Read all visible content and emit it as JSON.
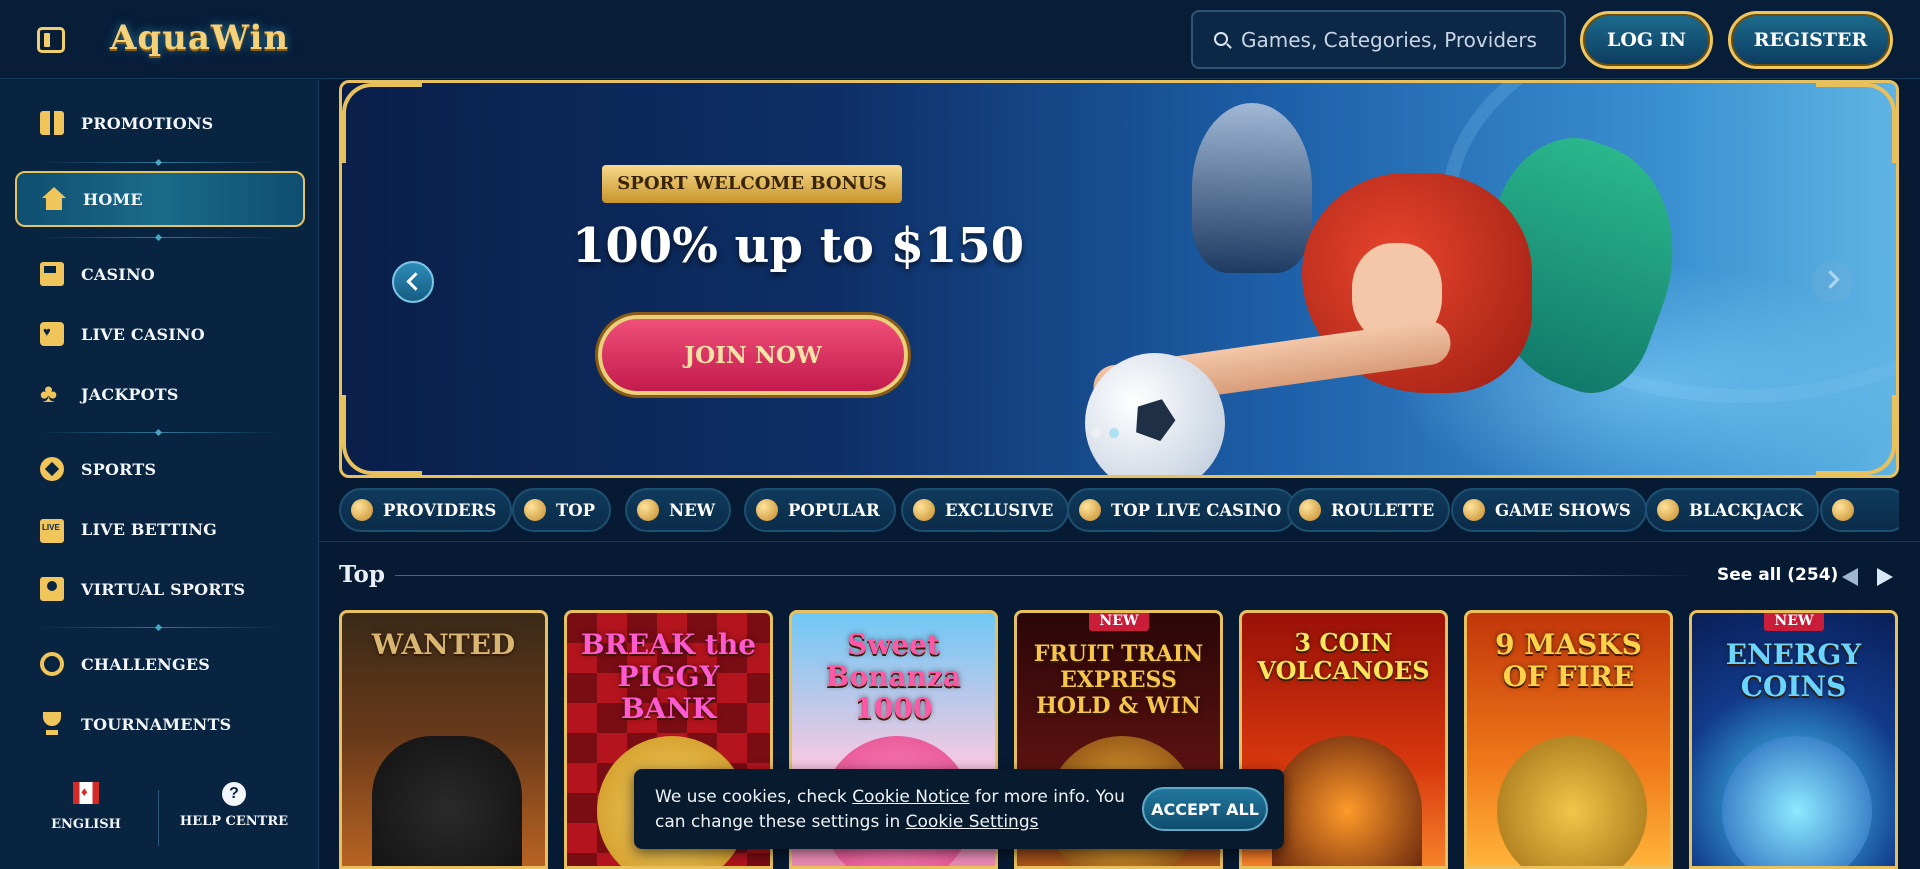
{
  "header": {
    "logo": "AquaWin",
    "search_placeholder": "Games, Categories, Providers",
    "login_label": "LOG IN",
    "register_label": "REGISTER"
  },
  "sidebar": {
    "items": [
      {
        "label": "PROMOTIONS",
        "icon": "gift-icon"
      },
      {
        "label": "HOME",
        "icon": "home-icon",
        "active": true
      },
      {
        "label": "CASINO",
        "icon": "slot-machine-icon"
      },
      {
        "label": "LIVE CASINO",
        "icon": "card-icon"
      },
      {
        "label": "JACKPOTS",
        "icon": "clover-icon"
      },
      {
        "label": "SPORTS",
        "icon": "soccer-ball-icon"
      },
      {
        "label": "LIVE BETTING",
        "icon": "live-icon"
      },
      {
        "label": "VIRTUAL SPORTS",
        "icon": "virtual-sports-icon"
      },
      {
        "label": "CHALLENGES",
        "icon": "badge-icon"
      },
      {
        "label": "TOURNAMENTS",
        "icon": "trophy-icon"
      }
    ],
    "language_label": "ENGLISH",
    "help_label": "HELP CENTRE",
    "help_glyph": "?"
  },
  "banner": {
    "ribbon": "SPORT WELCOME BONUS",
    "amount": "100% up to $150",
    "cta": "JOIN NOW"
  },
  "categories": [
    {
      "label": "PROVIDERS"
    },
    {
      "label": "TOP"
    },
    {
      "label": "NEW"
    },
    {
      "label": "POPULAR"
    },
    {
      "label": "EXCLUSIVE"
    },
    {
      "label": "TOP LIVE CASINO"
    },
    {
      "label": "ROULETTE"
    },
    {
      "label": "GAME SHOWS"
    },
    {
      "label": "BLACKJACK"
    }
  ],
  "top_section": {
    "title": "Top",
    "see_all": "See all (254)"
  },
  "games": [
    {
      "title": "WANTED",
      "new": false
    },
    {
      "title": "BREAK the PIGGY BANK",
      "new": false
    },
    {
      "title": "Sweet Bonanza 1000",
      "new": false
    },
    {
      "title": "FRUIT TRAIN EXPRESS HOLD & WIN",
      "new": true
    },
    {
      "title": "3 COIN VOLCANOES",
      "new": false
    },
    {
      "title": "9 MASKS OF FIRE",
      "new": false
    },
    {
      "title": "ENERGY COINS",
      "new": true
    }
  ],
  "new_tag": "NEW",
  "cookie": {
    "text_1": "We use cookies, check ",
    "link_1": "Cookie Notice",
    "text_2": " for more info. You can change these settings in ",
    "link_2": "Cookie Settings",
    "accept": "ACCEPT ALL"
  }
}
